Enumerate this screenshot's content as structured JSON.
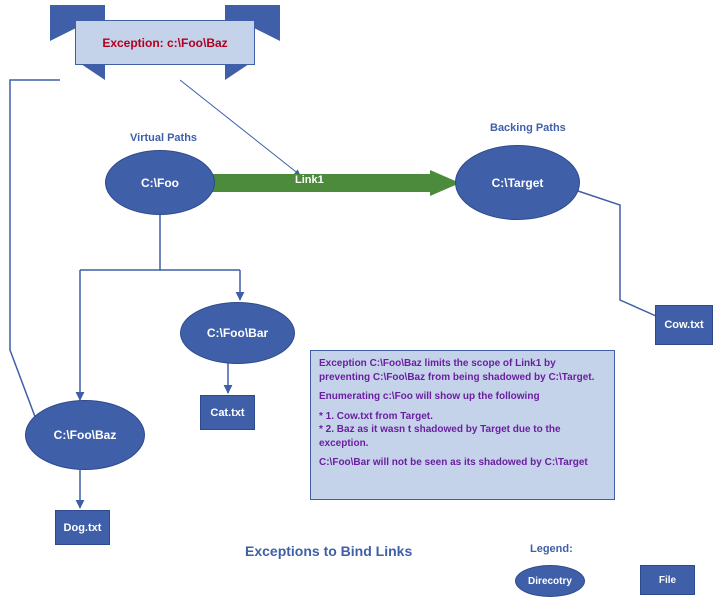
{
  "banner": {
    "text": "Exception: c:\\Foo\\Baz"
  },
  "sections": {
    "virtual_label": "Virtual Paths",
    "backing_label": "Backing Paths"
  },
  "nodes": {
    "foo": "C:\\Foo",
    "target": "C:\\Target",
    "foobar": "C:\\Foo\\Bar",
    "foobaz": "C:\\Foo\\Baz"
  },
  "files": {
    "cat": "Cat.txt",
    "dog": "Dog.txt",
    "cow": "Cow.txt"
  },
  "link": {
    "label": "Link1"
  },
  "note": {
    "p1": "Exception C:\\Foo\\Baz limits the scope of Link1 by preventing C:\\Foo\\Baz from being shadowed by C:\\Target.",
    "p2": "Enumerating c:\\Foo will show up the following",
    "i1": "*   1. Cow.txt from Target.",
    "i2": "*   2. Baz as it wasn t shadowed by Target due to the",
    "i2b": "        exception.",
    "p3": "C:\\Foo\\Bar will not be seen as its shadowed by C:\\Target"
  },
  "footer": {
    "title": "Exceptions to Bind Links"
  },
  "legend": {
    "title": "Legend:",
    "dir": "Direcotry",
    "file": "File"
  }
}
